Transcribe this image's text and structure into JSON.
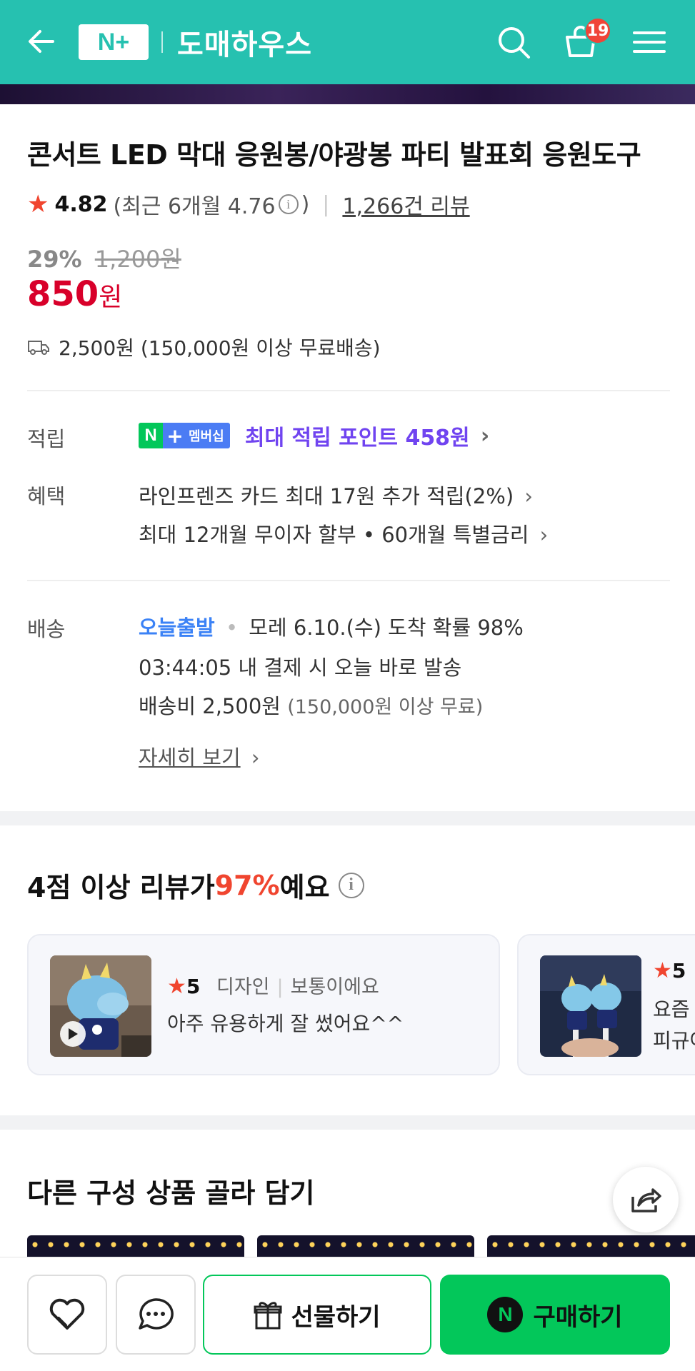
{
  "header": {
    "logo_text": "N+",
    "store_name": "도매하우스",
    "cart_count": "19",
    "icons": [
      "back-arrow-icon",
      "search-icon",
      "cart-icon",
      "menu-icon"
    ],
    "color": "#26c1b0"
  },
  "product": {
    "title": "콘서트 LED 막대 응원봉/야광봉 파티 발표회 응원도구",
    "rating": "4.82",
    "recent_rating": "(최근 6개월 4.76",
    "recent_rating_close": ")",
    "review_count": "1,266건 리뷰",
    "discount_pct": "29%",
    "original_price": "1,200원",
    "price": "850",
    "price_unit": "원",
    "shipping": "2,500원 (150,000원 이상 무료배송)"
  },
  "details": {
    "points_label": "적립",
    "membership_badge": "멤버십",
    "points_text": "최대 적립 포인트 458원",
    "benefit_label": "혜택",
    "benefit_1": "라인프렌즈 카드 최대 17원 추가 적립(2%)",
    "benefit_2": "최대 12개월 무이자 할부 • 60개월 특별금리",
    "delivery_label": "배송",
    "delivery_today": "오늘출발",
    "delivery_arrival": "모레 6.10.(수) 도착 확률 98%",
    "delivery_cutoff": "03:44:05  내 결제 시 오늘 바로 발송",
    "delivery_fee": "배송비 2,500원",
    "delivery_fee_note": "(150,000원 이상 무료)",
    "detail_link": "자세히 보기"
  },
  "reviews_section": {
    "title_prefix": "4점 이상 리뷰가 ",
    "title_pct": "97%",
    "title_suffix": "예요",
    "cards": [
      {
        "score": "5",
        "tag": "디자인",
        "tag_value": "보통이에요",
        "text": "아주 유용하게 잘 썼어요^^"
      },
      {
        "score": "5",
        "line1": "요즘",
        "line2": "피규어"
      }
    ]
  },
  "combo_section": {
    "title": "다른 구성 상품 골라 담기"
  },
  "bottom_bar": {
    "gift_label": "선물하기",
    "buy_label": "구매하기",
    "buy_badge": "N"
  }
}
